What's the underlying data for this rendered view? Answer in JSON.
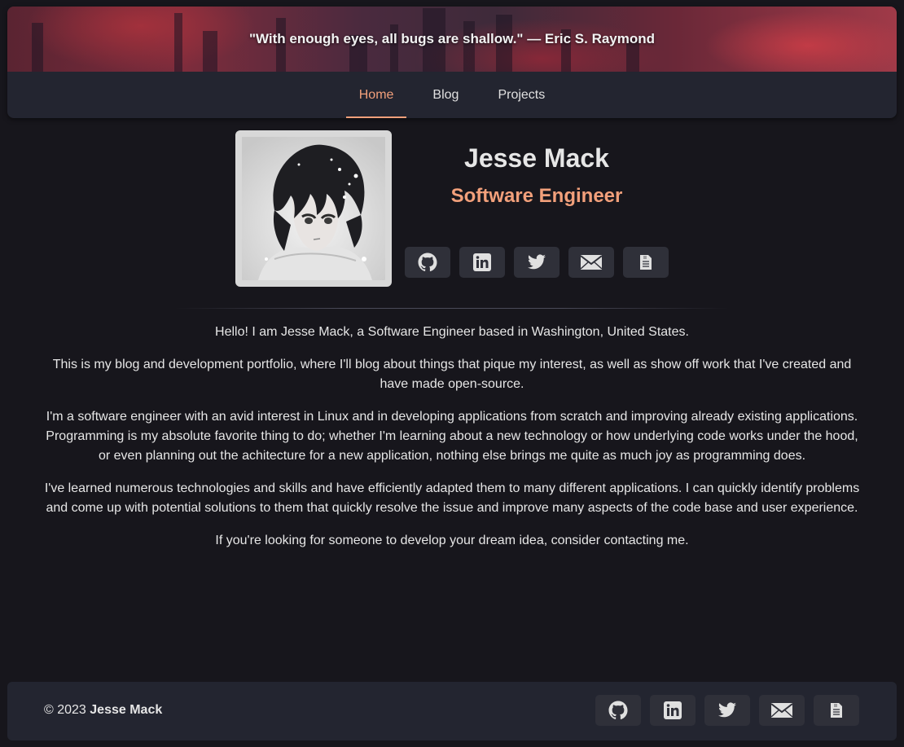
{
  "header": {
    "quote": "\"With enough eyes, all bugs are shallow.\" — Eric S. Raymond"
  },
  "nav": {
    "items": [
      {
        "label": "Home",
        "active": true
      },
      {
        "label": "Blog",
        "active": false
      },
      {
        "label": "Projects",
        "active": false
      }
    ]
  },
  "profile": {
    "name": "Jesse Mack",
    "title": "Software Engineer"
  },
  "social_links": [
    {
      "icon": "github-icon"
    },
    {
      "icon": "linkedin-icon"
    },
    {
      "icon": "twitter-icon"
    },
    {
      "icon": "mail-icon"
    },
    {
      "icon": "resume-document-icon"
    }
  ],
  "bio": {
    "paragraphs": [
      "Hello! I am Jesse Mack, a Software Engineer based in Washington, United States.",
      "This is my blog and development portfolio, where I'll blog about things that pique my interest, as well as show off work that I've created and have made open-source.",
      "I'm a software engineer with an avid interest in Linux and in developing applications from scratch and improving already existing applications. Programming is my absolute favorite thing to do; whether I'm learning about a new technology or how underlying code works under the hood, or even planning out the achitecture for a new application, nothing else brings me quite as much joy as programming does.",
      "I've learned numerous technologies and skills and have efficiently adapted them to many different applications. I can quickly identify problems and come up with potential solutions to them that quickly resolve the issue and improve many aspects of the code base and user experience.",
      "If you're looking for someone to develop your dream idea, consider contacting me."
    ]
  },
  "footer": {
    "copyright_prefix": "© 2023",
    "owner": "Jesse Mack"
  },
  "colors": {
    "accent": "#f2a07b",
    "background": "#17161c",
    "panel": "#232530",
    "button": "#2f3039"
  }
}
